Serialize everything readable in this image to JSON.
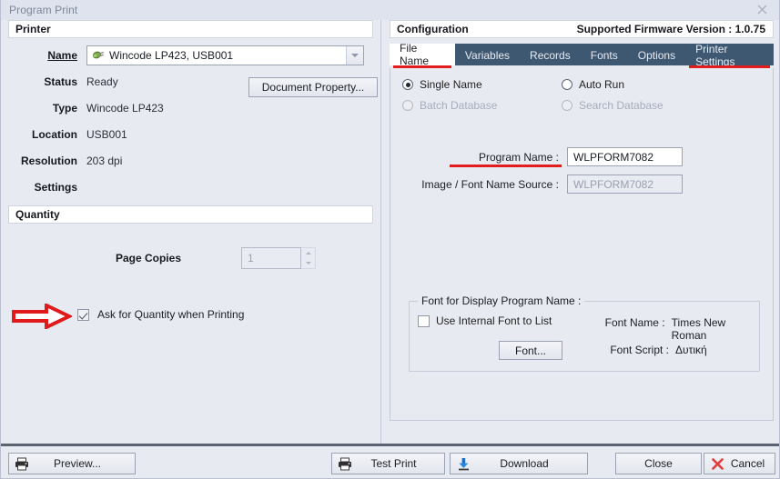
{
  "window": {
    "title": "Program Print",
    "close_label": "✕"
  },
  "printer": {
    "group_title": "Printer",
    "name_label": "Name",
    "name_value": "Wincode LP423,  USB001",
    "name_icon": "printer-plug-icon",
    "status_label": "Status",
    "status_value": "Ready",
    "type_label": "Type",
    "type_value": "Wincode LP423",
    "location_label": "Location",
    "location_value": "USB001",
    "resolution_label": "Resolution",
    "resolution_value": "203 dpi",
    "settings_label": "Settings",
    "settings_value": "",
    "document_property_button": "Document Property..."
  },
  "quantity": {
    "group_title": "Quantity",
    "page_copies_label": "Page Copies",
    "page_copies_value": "1",
    "ask_for_quantity_label": "Ask for Quantity when Printing",
    "ask_for_quantity_checked": true
  },
  "configuration": {
    "group_title": "Configuration",
    "firmware_text": "Supported Firmware Version : 1.0.75",
    "tabs": [
      {
        "label": "File Name",
        "active": true,
        "highlighted": true
      },
      {
        "label": "Variables",
        "active": false,
        "highlighted": false
      },
      {
        "label": "Records",
        "active": false,
        "highlighted": false
      },
      {
        "label": "Fonts",
        "active": false,
        "highlighted": false
      },
      {
        "label": "Options",
        "active": false,
        "highlighted": false
      },
      {
        "label": "Printer Settings",
        "active": false,
        "highlighted": true
      }
    ],
    "radios": [
      {
        "label": "Single Name",
        "selected": true,
        "disabled": false
      },
      {
        "label": "Auto Run",
        "selected": false,
        "disabled": false
      },
      {
        "label": "Batch Database",
        "selected": false,
        "disabled": true
      },
      {
        "label": "Search Database",
        "selected": false,
        "disabled": true
      }
    ],
    "program_name_label": "Program Name :",
    "program_name_value": "WLPFORM7082",
    "image_font_source_label": "Image / Font Name Source :",
    "image_font_source_value": "WLPFORM7082",
    "font_group": {
      "legend": "Font for Display Program Name :",
      "use_internal_font_label": "Use Internal Font to List",
      "use_internal_font_checked": false,
      "font_button": "Font...",
      "font_name_key": "Font Name :",
      "font_name_value": "Times New Roman",
      "font_script_key": "Font Script :",
      "font_script_value": "Δυτική"
    }
  },
  "bottom_bar": {
    "preview": "Preview...",
    "preview_icon": "printer-icon",
    "test_print": "Test Print",
    "test_print_icon": "printer-icon",
    "download": "Download",
    "download_icon": "download-arrow-icon",
    "close": "Close",
    "cancel": "Cancel",
    "cancel_icon": "red-x-icon"
  },
  "colors": {
    "tabbar_bg": "#3f5871",
    "accent_red": "#e11d1d",
    "window_bg": "#e8eaf2"
  }
}
